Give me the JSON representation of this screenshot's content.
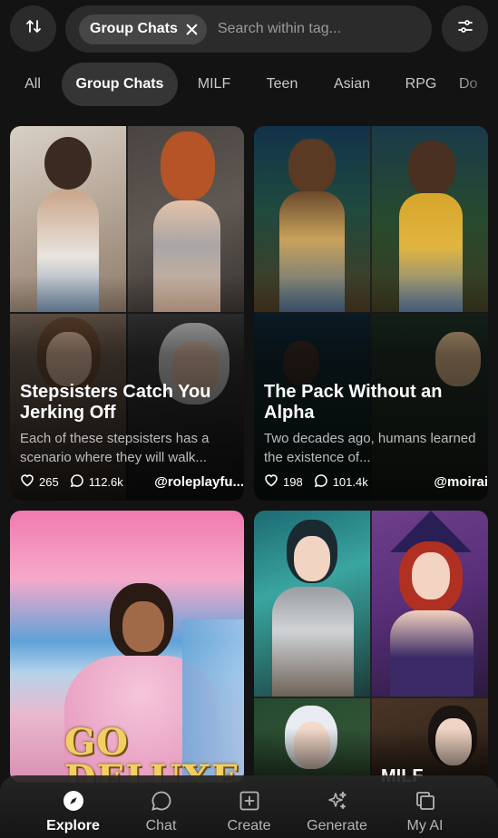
{
  "header": {
    "sort_icon": "sort-arrows-icon",
    "filter_icon": "filter-sliders-icon",
    "search": {
      "chip_label": "Group Chats",
      "placeholder": "Search within tag..."
    }
  },
  "tabs": [
    {
      "label": "All",
      "active": false
    },
    {
      "label": "Group Chats",
      "active": true
    },
    {
      "label": "MILF",
      "active": false
    },
    {
      "label": "Teen",
      "active": false
    },
    {
      "label": "Asian",
      "active": false
    },
    {
      "label": "RPG",
      "active": false
    },
    {
      "label": "Do",
      "active": false
    }
  ],
  "cards": [
    {
      "title": "Stepsisters Catch You Jerking Off",
      "description": "Each of these stepsisters has a scenario where they will walk...",
      "likes": "265",
      "chats": "112.6k",
      "author": "@roleplayfu..."
    },
    {
      "title": "The Pack Without an Alpha",
      "description": "Two decades ago, humans learned the existence of...",
      "likes": "198",
      "chats": "101.4k",
      "author": "@moirai"
    },
    {
      "title": "",
      "image_text": "GO DELUXE"
    },
    {
      "title": "",
      "partial_caption": "MILF"
    }
  ],
  "nav": [
    {
      "label": "Explore",
      "icon": "compass-icon",
      "active": true
    },
    {
      "label": "Chat",
      "icon": "chat-bubble-icon",
      "active": false
    },
    {
      "label": "Create",
      "icon": "plus-square-icon",
      "active": false
    },
    {
      "label": "Generate",
      "icon": "sparkles-icon",
      "active": false
    },
    {
      "label": "My AI",
      "icon": "stacked-cards-icon",
      "active": false
    }
  ],
  "colors": {
    "background": "#131313",
    "surface": "#2b2b2b",
    "chip": "#464646",
    "active_tab": "#353535",
    "muted_text": "#bdbdbd"
  }
}
